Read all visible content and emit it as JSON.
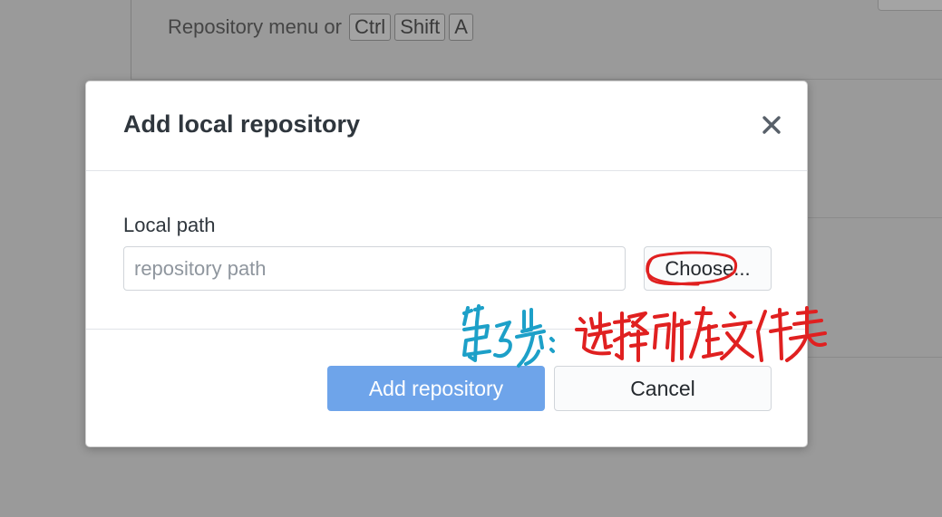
{
  "background": {
    "hint_text": "Repository menu or",
    "shortcut_keys": [
      "Ctrl",
      "Shift",
      "A"
    ]
  },
  "dialog": {
    "title": "Add local repository",
    "close_icon": "close-icon",
    "local_path_label": "Local path",
    "path_input": {
      "value": "",
      "placeholder": "repository path"
    },
    "choose_button": "Choose...",
    "add_button": "Add repository",
    "cancel_button": "Cancel",
    "primary_color": "#6ea4ea"
  },
  "annotation": {
    "handwritten_note": "第3步：选择所在文件夹",
    "note_colors": [
      "#1da0c8",
      "#e02020"
    ],
    "highlight_color": "#e02020"
  }
}
